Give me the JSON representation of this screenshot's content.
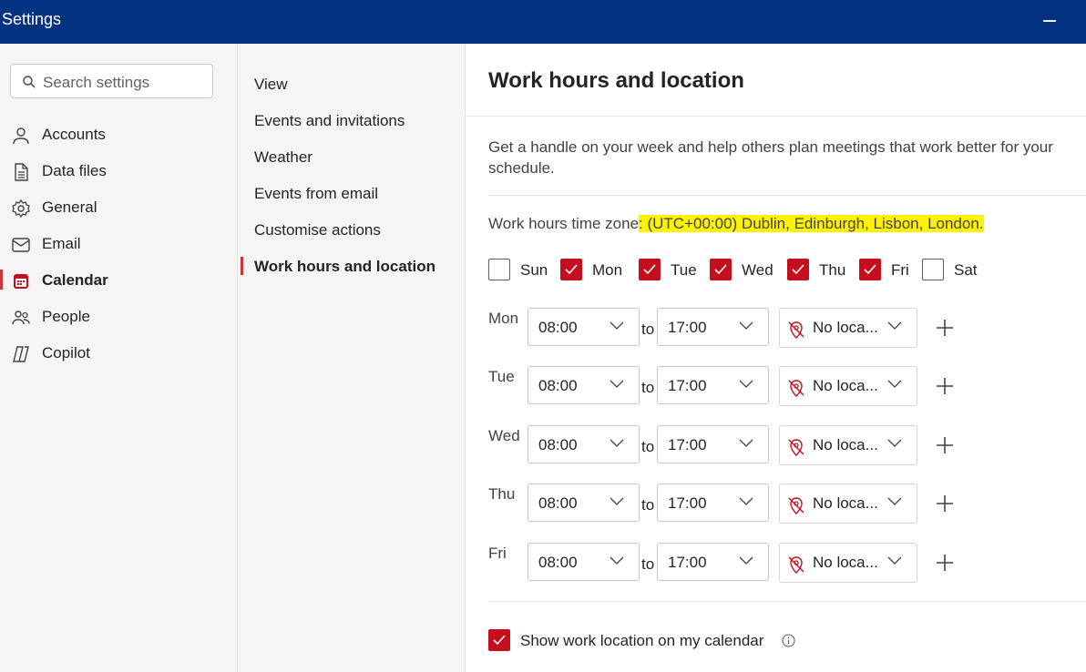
{
  "window": {
    "title": "Settings"
  },
  "search": {
    "placeholder": "Search settings"
  },
  "nav": [
    {
      "label": "Accounts",
      "icon": "person-icon"
    },
    {
      "label": "Data files",
      "icon": "document-icon"
    },
    {
      "label": "General",
      "icon": "gear-icon"
    },
    {
      "label": "Email",
      "icon": "mail-icon"
    },
    {
      "label": "Calendar",
      "icon": "calendar-icon",
      "active": true
    },
    {
      "label": "People",
      "icon": "people-icon"
    },
    {
      "label": "Copilot",
      "icon": "copilot-icon"
    }
  ],
  "subnav": [
    {
      "label": "View"
    },
    {
      "label": "Events and invitations"
    },
    {
      "label": "Weather"
    },
    {
      "label": "Events from email"
    },
    {
      "label": "Customise actions"
    },
    {
      "label": "Work hours and location",
      "active": true
    }
  ],
  "page": {
    "title": "Work hours and location",
    "description": "Get a handle on your week and help others plan meetings that work better for your schedule.",
    "timezone_label": "Work hours time zone",
    "timezone_value": ": (UTC+00:00) Dublin, Edinburgh, Lisbon, London."
  },
  "days": [
    {
      "label": "Sun",
      "checked": false
    },
    {
      "label": "Mon",
      "checked": true
    },
    {
      "label": "Tue",
      "checked": true
    },
    {
      "label": "Wed",
      "checked": true
    },
    {
      "label": "Thu",
      "checked": true
    },
    {
      "label": "Fri",
      "checked": true
    },
    {
      "label": "Sat",
      "checked": false
    }
  ],
  "rows": [
    {
      "day": "Mon",
      "start": "08:00",
      "to": "to",
      "end": "17:00",
      "location": "No loca..."
    },
    {
      "day": "Tue",
      "start": "08:00",
      "to": "to",
      "end": "17:00",
      "location": "No loca..."
    },
    {
      "day": "Wed",
      "start": "08:00",
      "to": "to",
      "end": "17:00",
      "location": "No loca..."
    },
    {
      "day": "Thu",
      "start": "08:00",
      "to": "to",
      "end": "17:00",
      "location": "No loca..."
    },
    {
      "day": "Fri",
      "start": "08:00",
      "to": "to",
      "end": "17:00",
      "location": "No loca..."
    }
  ],
  "show_location": {
    "label": "Show work location on my calendar",
    "checked": true
  },
  "colors": {
    "titlebar": "#033281",
    "accent": "#c50f1f",
    "highlight": "#fff200"
  }
}
